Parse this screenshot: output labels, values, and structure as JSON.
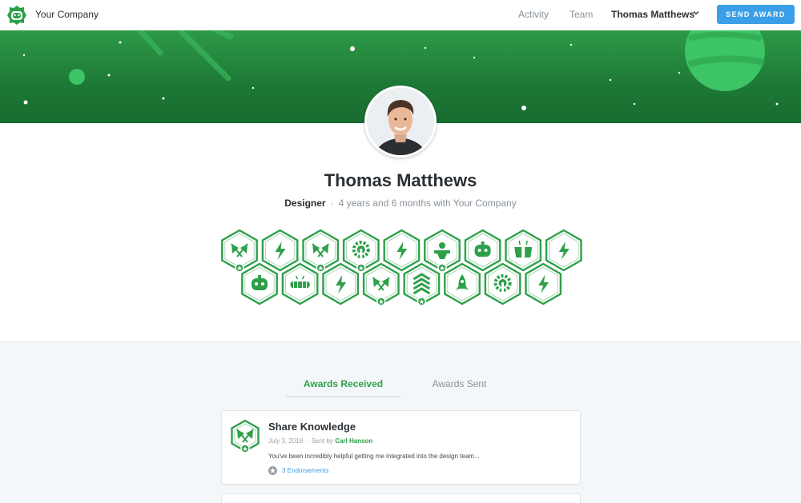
{
  "nav": {
    "brand": "Your Company",
    "links": [
      "Activity",
      "Team"
    ],
    "user": "Thomas Matthews",
    "send_award": "SEND AWARD"
  },
  "profile": {
    "name": "Thomas Matthews",
    "role": "Designer",
    "separator": "·",
    "tenure": "4 years and 6 months with Your Company"
  },
  "badges": {
    "row1": [
      "flags",
      "bolt",
      "flags",
      "gear-wrench",
      "bolt",
      "teacher",
      "robot",
      "hands",
      "bolt"
    ],
    "row2": [
      "robot",
      "goggles",
      "bolt",
      "flags",
      "chevrons",
      "rocket",
      "gear-wrench",
      "bolt"
    ]
  },
  "tabs": {
    "received": "Awards Received",
    "sent": "Awards Sent"
  },
  "award": {
    "title": "Share Knowledge",
    "date": "July 3, 2018",
    "separator": "·",
    "sent_by_label": "Sent by",
    "sender": "Carl Hanson",
    "message": "You've been incredibly helpful getting me integrated into the design team...",
    "endorsements": "3 Endorsements",
    "icon": "flags"
  },
  "colors": {
    "accent_green": "#2ea04a",
    "banner_green": "#1e7a37",
    "button_blue": "#3a9fe8"
  }
}
